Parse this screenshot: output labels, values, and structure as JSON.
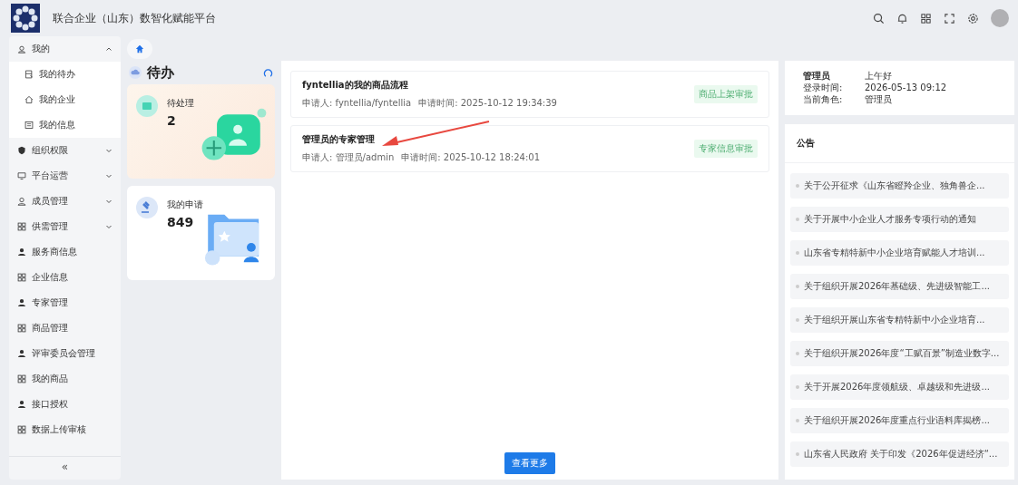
{
  "header": {
    "title": "联合企业（山东）数智化赋能平台"
  },
  "sidebar": {
    "items": [
      {
        "kind": "group",
        "label": "我的",
        "expanded": true,
        "children": [
          {
            "label": "我的待办"
          },
          {
            "label": "我的企业"
          },
          {
            "label": "我的信息"
          }
        ]
      },
      {
        "kind": "group",
        "label": "组织权限",
        "expanded": false
      },
      {
        "kind": "group",
        "label": "平台运营",
        "expanded": false
      },
      {
        "kind": "group",
        "label": "成员管理",
        "expanded": false
      },
      {
        "kind": "group",
        "label": "供需管理",
        "expanded": false
      },
      {
        "kind": "link",
        "label": "服务商信息"
      },
      {
        "kind": "link",
        "label": "企业信息"
      },
      {
        "kind": "link",
        "label": "专家管理"
      },
      {
        "kind": "link",
        "label": "商品管理"
      },
      {
        "kind": "link",
        "label": "评审委员会管理"
      },
      {
        "kind": "link",
        "label": "我的商品"
      },
      {
        "kind": "link",
        "label": "接口授权"
      },
      {
        "kind": "link",
        "label": "数据上传审核"
      }
    ],
    "collapse": "«"
  },
  "todo": {
    "title": "待办",
    "cards": [
      {
        "kind": "pending",
        "label": "待处理",
        "count": "2"
      },
      {
        "kind": "applied",
        "label": "我的申请",
        "count": "849"
      }
    ]
  },
  "tasks": {
    "items": [
      {
        "title": "fyntellia的我的商品流程",
        "applicant": "申请人: fyntellia/fyntellia",
        "time": "申请时间: 2025-10-12 19:34:39",
        "tag": "商品上架审批"
      },
      {
        "title": "管理员的专家管理",
        "applicant": "申请人: 管理员/admin",
        "time": "申请时间: 2025-10-12 18:24:01",
        "tag": "专家信息审批"
      }
    ],
    "more": "查看更多"
  },
  "profile": {
    "name": "管理员",
    "greeting": "上午好",
    "rows": [
      {
        "label": "登录时间:",
        "value": "2026-05-13 09:12"
      },
      {
        "label": "当前角色:",
        "value": "管理员"
      }
    ]
  },
  "notices": {
    "title": "公告",
    "items": [
      "关于公开征求《山东省瞪羚企业、独角兽企...",
      "关于开展中小企业人才服务专项行动的通知",
      "山东省专精特新中小企业培育赋能人才培训...",
      "关于组织开展2026年基础级、先进级智能工...",
      "关于组织开展山东省专精特新中小企业培育...",
      "关于组织开展2026年度“工赋百景”制造业数字...",
      "关于开展2026年度领航级、卓越级和先进级...",
      "关于组织开展2026年度重点行业语料库揭榜...",
      "山东省人民政府 关于印发《2026年促进经济“..."
    ]
  }
}
